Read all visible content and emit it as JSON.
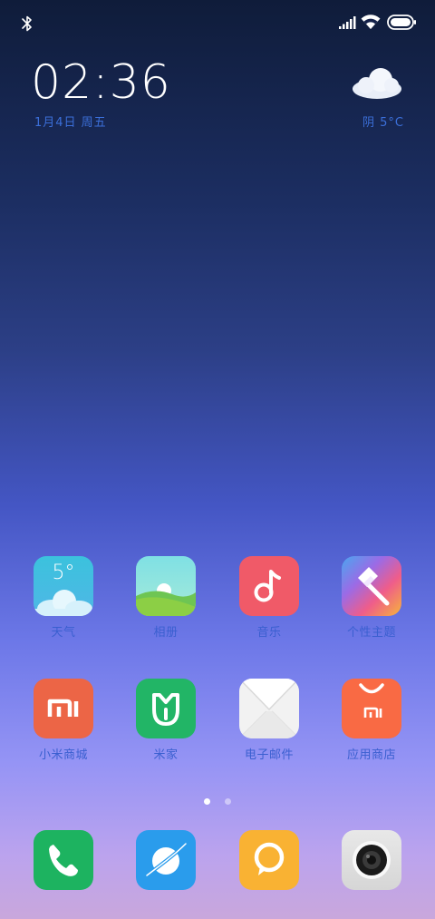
{
  "clock": {
    "time": "02:36",
    "date": "1月4日 周五"
  },
  "weather": {
    "summary": "阴  5°C",
    "icon": "cloud-icon"
  },
  "apps": [
    {
      "label": "天气",
      "icon": "weather-app-icon",
      "badge": "5°"
    },
    {
      "label": "相册",
      "icon": "gallery-app-icon"
    },
    {
      "label": "音乐",
      "icon": "music-app-icon"
    },
    {
      "label": "个性主题",
      "icon": "themes-app-icon"
    },
    {
      "label": "小米商城",
      "icon": "mi-store-app-icon",
      "badge": "MI"
    },
    {
      "label": "米家",
      "icon": "mijia-app-icon"
    },
    {
      "label": "电子邮件",
      "icon": "email-app-icon"
    },
    {
      "label": "应用商店",
      "icon": "app-store-app-icon",
      "badge": "MI"
    }
  ],
  "dock": [
    {
      "icon": "phone-app-icon"
    },
    {
      "icon": "browser-app-icon"
    },
    {
      "icon": "messaging-app-icon"
    },
    {
      "icon": "camera-app-icon"
    }
  ],
  "page_indicator": {
    "current": 1,
    "total": 2
  },
  "colors": {
    "date_text": "#3b6fd9",
    "weather_icon_bg": "#3cc3dd",
    "music_icon_bg": "#f05a68",
    "mi_store_bg": "#ec6546",
    "mijia_bg": "#22b566",
    "app_store_bg": "#f96a44",
    "phone_bg": "#1db360",
    "browser_bg": "#2a9cec",
    "messaging_bg": "#f9b233"
  }
}
